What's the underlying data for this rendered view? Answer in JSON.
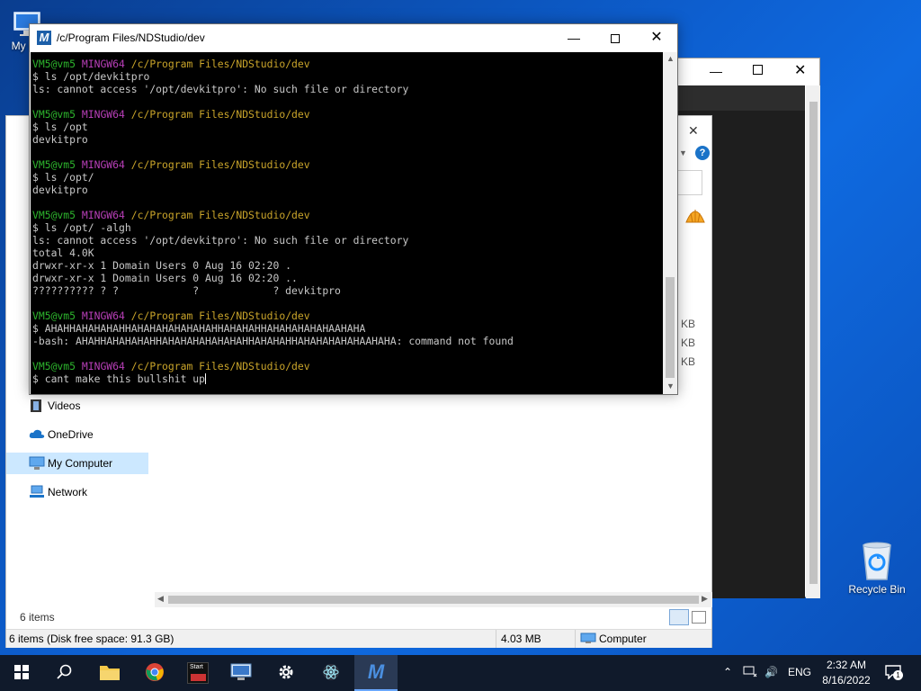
{
  "desktop": {
    "my_computer_label": "My Co",
    "recycle_bin_label": "Recycle Bin"
  },
  "terminal": {
    "title": "/c/Program Files/NDStudio/dev",
    "prompt": {
      "user": "VM5@vm5",
      "host": "MINGW64",
      "path": "/c/Program Files/NDStudio/dev"
    },
    "blocks": [
      {
        "cmd": "$ ls /opt/devkitpro",
        "out": [
          "ls: cannot access '/opt/devkitpro': No such file or directory"
        ]
      },
      {
        "cmd": "$ ls /opt",
        "out": [
          "devkitpro"
        ]
      },
      {
        "cmd": "$ ls /opt/",
        "out": [
          "devkitpro"
        ]
      },
      {
        "cmd": "$ ls /opt/ -algh",
        "out": [
          "ls: cannot access '/opt/devkitpro': No such file or directory",
          "total 4.0K",
          "drwxr-xr-x 1 Domain Users 0 Aug 16 02:20 .",
          "drwxr-xr-x 1 Domain Users 0 Aug 16 02:20 ..",
          "?????????? ? ?            ?            ? devkitpro"
        ]
      },
      {
        "cmd": "$ AHAHHAHAHAHAHHAHAHAHAHAHAHAHHAHAHAHHAHAHAHAHAHAAHAHA",
        "out": [
          "-bash: AHAHHAHAHAHAHHAHAHAHAHAHAHAHHAHAHAHHAHAHAHAHAHAAHAHA: command not found"
        ]
      }
    ],
    "current_input": "$ cant make this bullshit up"
  },
  "explorer": {
    "nav": {
      "videos": "Videos",
      "onedrive": "OneDrive",
      "my_computer": "My Computer",
      "network": "Network"
    },
    "sizes": [
      "1 KB",
      "7 KB",
      "3 KB"
    ],
    "item_count": "6 items",
    "status_left": "6 items (Disk free space: 91.3 GB)",
    "status_size": "4.03 MB",
    "status_location": "Computer"
  },
  "taskbar": {
    "start_tile_label": "Start",
    "language": "ENG",
    "time": "2:32 AM",
    "date": "8/16/2022",
    "notification_count": "1"
  }
}
